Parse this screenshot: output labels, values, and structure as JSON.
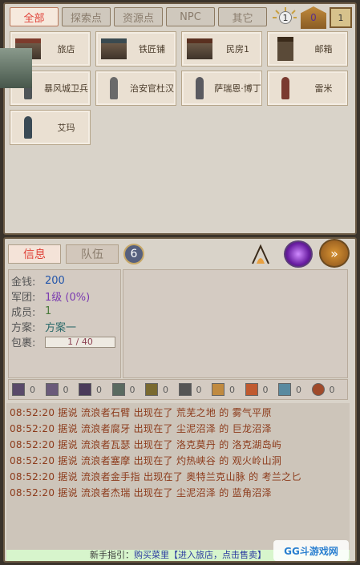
{
  "filter_tabs": [
    "全部",
    "探索点",
    "资源点",
    "NPC",
    "其它"
  ],
  "top_icons": {
    "sun_count": "1",
    "gem_count": "0",
    "bag_count": "1"
  },
  "locations": [
    {
      "name": "旅店",
      "icon": "inn-building-icon"
    },
    {
      "name": "铁匠铺",
      "icon": "blacksmith-building-icon"
    },
    {
      "name": "民房1",
      "icon": "house-building-icon"
    },
    {
      "name": "邮箱",
      "icon": "mailbox-icon"
    },
    {
      "name": "暴风城卫兵",
      "icon": "guard-figure-icon"
    },
    {
      "name": "治安官杜汉",
      "icon": "sheriff-figure-icon"
    },
    {
      "name": "萨瑞恩·博丁",
      "icon": "npc-figure-icon"
    },
    {
      "name": "雷米",
      "icon": "npc-figure-icon"
    },
    {
      "name": "艾玛",
      "icon": "npc-figure-icon"
    }
  ],
  "panel_tabs": {
    "info": "信息",
    "team": "队伍",
    "team_count": "6"
  },
  "stats": {
    "money_label": "金钱:",
    "money": "200",
    "legion_label": "军团:",
    "legion": "1级 (0%)",
    "members_label": "成员:",
    "members": "1",
    "plan_label": "方案:",
    "plan": "方案一",
    "bag_label": "包裹:",
    "bag": "1 / 40"
  },
  "inventory": [
    "0",
    "0",
    "0",
    "0",
    "0",
    "0",
    "0",
    "0",
    "0",
    "0"
  ],
  "log": [
    {
      "time": "08:52:20",
      "text": "据说 流浪者石臂 出现在了 荒芜之地 的 雾气平原"
    },
    {
      "time": "08:52:20",
      "text": "据说 流浪者腐牙 出现在了 尘泥沼泽 的 巨龙沼泽"
    },
    {
      "time": "08:52:20",
      "text": "据说 流浪者瓦瑟 出现在了 洛克莫丹 的 洛克湖岛屿"
    },
    {
      "time": "08:52:20",
      "text": "据说 流浪者塞摩 出现在了 灼热峡谷 的 观火岭山洞"
    },
    {
      "time": "08:52:20",
      "text": "据说 流浪者金手指 出现在了 奥特兰克山脉 的 考兰之匕"
    },
    {
      "time": "08:52:20",
      "text": "据说 流浪者杰瑞 出现在了 尘泥沼泽 的 蓝角沼泽"
    }
  ],
  "guide": {
    "prefix": "新手指引：",
    "link": "购买菜里【进入旅店，点击售卖】"
  },
  "watermark": "GG斗游戏网"
}
